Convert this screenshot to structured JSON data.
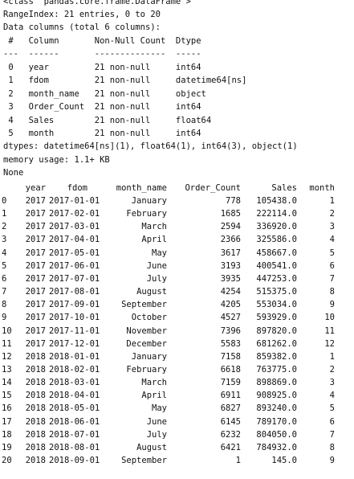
{
  "info": {
    "class_line": "<class 'pandas.core.frame.DataFrame'>",
    "range_line": "RangeIndex: 21 entries, 0 to 20",
    "columns_line": "Data columns (total 6 columns):",
    "header": " #   Column       Non-Null Count  Dtype",
    "separator": "---  ------       --------------  -----",
    "columns": [
      " 0   year         21 non-null     int64",
      " 1   fdom         21 non-null     datetime64[ns]",
      " 2   month_name   21 non-null     object",
      " 3   Order_Count  21 non-null     int64",
      " 4   Sales        21 non-null     float64",
      " 5   month        21 non-null     int64"
    ],
    "dtypes_line": "dtypes: datetime64[ns](1), float64(1), int64(3), object(1)",
    "memory_line": "memory usage: 1.1+ KB",
    "return_value": "None"
  },
  "table": {
    "headers": [
      "",
      "year",
      "fdom",
      "month_name",
      "Order_Count",
      "Sales",
      "month"
    ],
    "rows": [
      [
        "0",
        "2017",
        "2017-01-01",
        "January",
        "778",
        "105438.0",
        "1"
      ],
      [
        "1",
        "2017",
        "2017-02-01",
        "February",
        "1685",
        "222114.0",
        "2"
      ],
      [
        "2",
        "2017",
        "2017-03-01",
        "March",
        "2594",
        "336920.0",
        "3"
      ],
      [
        "3",
        "2017",
        "2017-04-01",
        "April",
        "2366",
        "325586.0",
        "4"
      ],
      [
        "4",
        "2017",
        "2017-05-01",
        "May",
        "3617",
        "458667.0",
        "5"
      ],
      [
        "5",
        "2017",
        "2017-06-01",
        "June",
        "3193",
        "400541.0",
        "6"
      ],
      [
        "6",
        "2017",
        "2017-07-01",
        "July",
        "3935",
        "447253.0",
        "7"
      ],
      [
        "7",
        "2017",
        "2017-08-01",
        "August",
        "4254",
        "515375.0",
        "8"
      ],
      [
        "8",
        "2017",
        "2017-09-01",
        "September",
        "4205",
        "553034.0",
        "9"
      ],
      [
        "9",
        "2017",
        "2017-10-01",
        "October",
        "4527",
        "593929.0",
        "10"
      ],
      [
        "10",
        "2017",
        "2017-11-01",
        "November",
        "7396",
        "897820.0",
        "11"
      ],
      [
        "11",
        "2017",
        "2017-12-01",
        "December",
        "5583",
        "681262.0",
        "12"
      ],
      [
        "12",
        "2018",
        "2018-01-01",
        "January",
        "7158",
        "859382.0",
        "1"
      ],
      [
        "13",
        "2018",
        "2018-02-01",
        "February",
        "6618",
        "763775.0",
        "2"
      ],
      [
        "14",
        "2018",
        "2018-03-01",
        "March",
        "7159",
        "898869.0",
        "3"
      ],
      [
        "15",
        "2018",
        "2018-04-01",
        "April",
        "6911",
        "908925.0",
        "4"
      ],
      [
        "16",
        "2018",
        "2018-05-01",
        "May",
        "6827",
        "893240.0",
        "5"
      ],
      [
        "17",
        "2018",
        "2018-06-01",
        "June",
        "6145",
        "789170.0",
        "6"
      ],
      [
        "18",
        "2018",
        "2018-07-01",
        "July",
        "6232",
        "804050.0",
        "7"
      ],
      [
        "19",
        "2018",
        "2018-08-01",
        "August",
        "6421",
        "784932.0",
        "8"
      ],
      [
        "20",
        "2018",
        "2018-09-01",
        "September",
        "1",
        "145.0",
        "9"
      ]
    ]
  }
}
